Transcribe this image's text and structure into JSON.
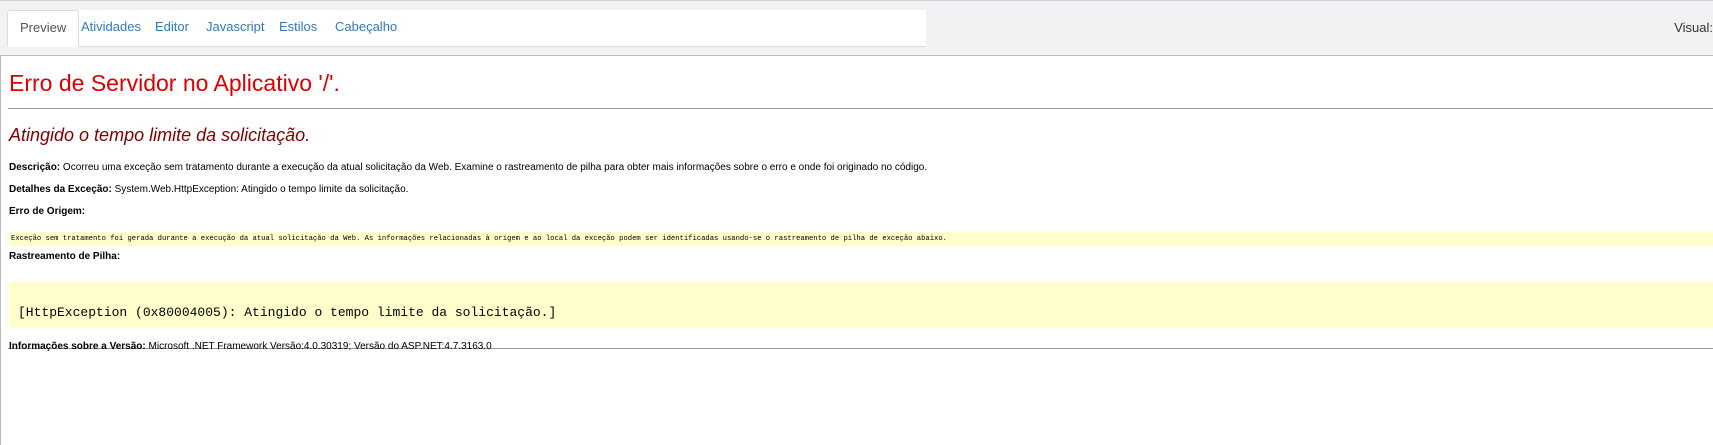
{
  "tabs": [
    {
      "label": "Preview",
      "active": true
    },
    {
      "label": "Atividades"
    },
    {
      "label": "Editor"
    },
    {
      "label": "Javascript"
    },
    {
      "label": "Estilos"
    },
    {
      "label": "Cabeçalho"
    }
  ],
  "visual_label": "Visual:",
  "error": {
    "title": "Erro de Servidor no Aplicativo '/'.",
    "subtitle": "Atingido o tempo limite da solicitação.",
    "description_label": "Descrição:",
    "description_text": "Ocorreu uma exceção sem tratamento durante a execução da atual solicitação da Web. Examine o rastreamento de pilha para obter mais informações sobre o erro e onde foi originado no código.",
    "details_label": "Detalhes da Exceção:",
    "details_text": "System.Web.HttpException: Atingido o tempo limite da solicitação.",
    "source_label": "Erro de Origem:",
    "source_text": "Exceção sem tratamento foi gerada durante a execução da atual solicitação da Web. As informações relacionadas à origem e ao local da exceção podem ser identificadas usando-se o rastreamento de pilha de exceção abaixo.",
    "stack_label": "Rastreamento de Pilha:",
    "stack_text": "[HttpException (0x80004005): Atingido o tempo limite da solicitação.]",
    "version_label": "Informações sobre a Versão:",
    "version_text": "Microsoft .NET Framework Versão:4.0.30319; Versão do ASP.NET:4.7.3163.0"
  },
  "colors": {
    "title": "#dd0000",
    "subtitle": "#800000",
    "code_background": "#ffffcc",
    "tab_link": "#337ab7"
  }
}
